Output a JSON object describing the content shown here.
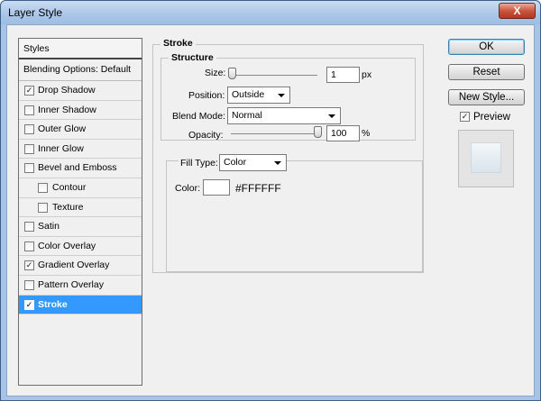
{
  "window": {
    "title": "Layer Style",
    "close_glyph": "X"
  },
  "styles_panel": {
    "header": "Styles",
    "blending_options": "Blending Options: Default",
    "items": [
      {
        "label": "Drop Shadow",
        "checked": true,
        "check": "✓"
      },
      {
        "label": "Inner Shadow",
        "checked": false,
        "check": ""
      },
      {
        "label": "Outer Glow",
        "checked": false,
        "check": ""
      },
      {
        "label": "Inner Glow",
        "checked": false,
        "check": ""
      },
      {
        "label": "Bevel and Emboss",
        "checked": false,
        "check": ""
      },
      {
        "label": "Contour",
        "checked": false,
        "check": ""
      },
      {
        "label": "Texture",
        "checked": false,
        "check": ""
      },
      {
        "label": "Satin",
        "checked": false,
        "check": ""
      },
      {
        "label": "Color Overlay",
        "checked": false,
        "check": ""
      },
      {
        "label": "Gradient Overlay",
        "checked": true,
        "check": "✓"
      },
      {
        "label": "Pattern Overlay",
        "checked": false,
        "check": ""
      },
      {
        "label": "Stroke",
        "checked": true,
        "check": "✓"
      }
    ]
  },
  "stroke": {
    "section_title": "Stroke",
    "structure_title": "Structure",
    "size_label": "Size:",
    "size_value": "1",
    "size_unit": "px",
    "position_label": "Position:",
    "position_value": "Outside",
    "blend_mode_label": "Blend Mode:",
    "blend_mode_value": "Normal",
    "opacity_label": "Opacity:",
    "opacity_value": "100",
    "opacity_unit": "%",
    "fill_type_label": "Fill Type:",
    "fill_type_value": "Color",
    "color_label": "Color:",
    "color_hex": "#FFFFFF"
  },
  "buttons": {
    "ok": "OK",
    "reset": "Reset",
    "new_style": "New Style...",
    "preview_label": "Preview",
    "preview_checked": true,
    "preview_check": "✓"
  },
  "colors": {
    "selection": "#3399ff",
    "titlebar": "#a9c6e8",
    "stroke_color": "#FFFFFF"
  }
}
